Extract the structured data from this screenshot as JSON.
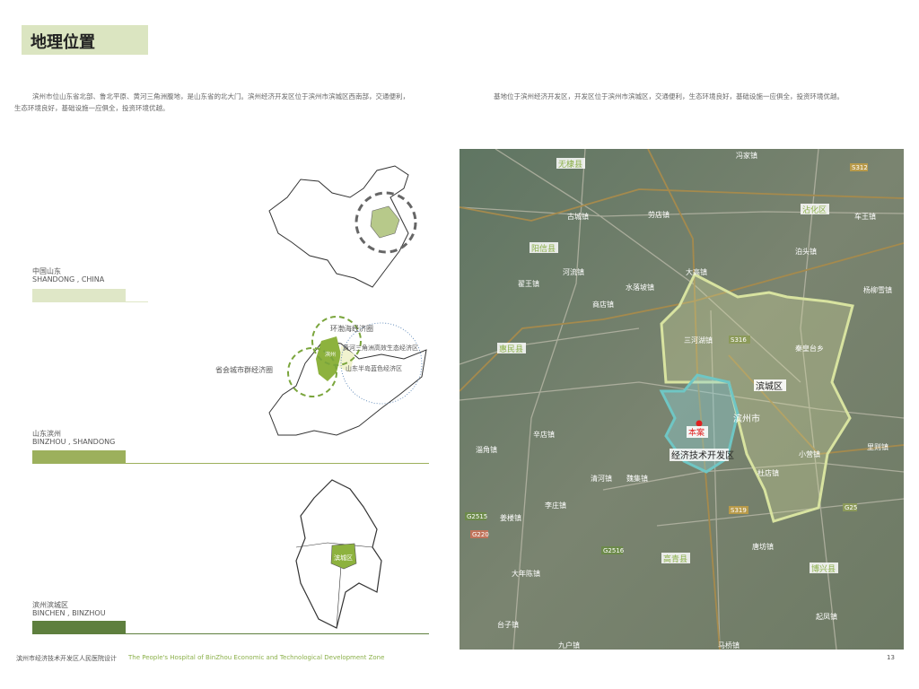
{
  "header": {
    "title": "地理位置"
  },
  "intro": {
    "left_line1": "滨州市位山东省北部、鲁北平原、黄河三角洲腹地，是山东省的北大门。滨州经济开发区位于滨州市滨城区西南部，交通便利，",
    "left_line2": "生态环境良好，基础设施一应俱全，投资环境优越。",
    "right": "基地位于滨州经济开发区，开发区位于滨州市滨城区，交通便利，生态环境良好，基础设施一应俱全，投资环境优越。"
  },
  "levels": [
    {
      "cn": "中国山东",
      "en": "SHANDONG , CHINA",
      "color": "#dfe7c7"
    },
    {
      "cn": "山东滨州",
      "en": "BINZHOU , SHANDONG",
      "color": "#9cb05c"
    },
    {
      "cn": "滨州滨城区",
      "en": "BINCHEN , BINZHOU",
      "color": "#5e7f3e"
    }
  ],
  "shandong_map": {
    "ring1": "环渤海经济圈",
    "ring2": "黄河三角洲高效生态经济区",
    "ring3": "山东半岛蓝色经济区",
    "ring4": "省会城市群经济圈",
    "city": "滨州"
  },
  "binzhou_map": {
    "district": "滨城区"
  },
  "satellite_map": {
    "counties": [
      "无棣县",
      "沾化区",
      "阳信县",
      "惠民县",
      "高青县",
      "博兴县"
    ],
    "district": "滨城区",
    "city": "滨州市",
    "site": "本案",
    "zone": "经济技术开发区",
    "towns": [
      "冯家镇",
      "车王镇",
      "古城镇",
      "劳店镇",
      "河流镇",
      "翟王镇",
      "水落坡镇",
      "商店镇",
      "大高镇",
      "泊头镇",
      "三河湖镇",
      "秦皇台乡",
      "辛店镇",
      "淄角镇",
      "清河镇",
      "魏集镇",
      "李庄镇",
      "姜楼镇",
      "大年陈镇",
      "台子镇",
      "九户镇",
      "唐坊镇",
      "马桥镇",
      "小营镇",
      "杜店镇",
      "起凤镇",
      "里则镇",
      "杨柳雪镇"
    ],
    "roads": [
      "S312",
      "G2516",
      "G2515",
      "G220",
      "S319",
      "G25",
      "S316"
    ]
  },
  "footer": {
    "cn": "滨州市经济技术开发区人民医院设计",
    "en": "The People's Hospital of BinZhou Economic and Technological Development Zone",
    "page": "13"
  }
}
